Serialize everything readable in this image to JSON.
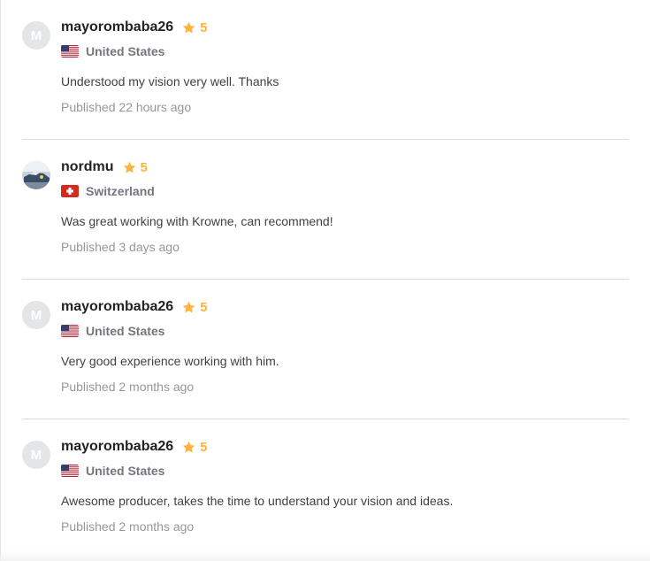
{
  "reviews": [
    {
      "avatar_letter": "M",
      "username": "mayorombaba26",
      "rating": "5",
      "country": "United States",
      "flag": "us-flag-icon",
      "comment": "Understood my vision very well. Thanks",
      "published": "Published 22 hours ago"
    },
    {
      "avatar_letter": "",
      "username": "nordmu",
      "rating": "5",
      "country": "Switzerland",
      "flag": "ch-flag-icon",
      "comment": "Was great working with Krowne, can recommend!",
      "published": "Published 3 days ago"
    },
    {
      "avatar_letter": "M",
      "username": "mayorombaba26",
      "rating": "5",
      "country": "United States",
      "flag": "us-flag-icon",
      "comment": "Very good experience working with him.",
      "published": "Published 2 months ago"
    },
    {
      "avatar_letter": "M",
      "username": "mayorombaba26",
      "rating": "5",
      "country": "United States",
      "flag": "us-flag-icon",
      "comment": "Awesome producer, takes the time to understand your vision and ideas.",
      "published": "Published 2 months ago"
    }
  ],
  "colors": {
    "star": "#ffb33e",
    "avatar_bg": "#e4e5e7",
    "divider": "#dadbdd"
  }
}
